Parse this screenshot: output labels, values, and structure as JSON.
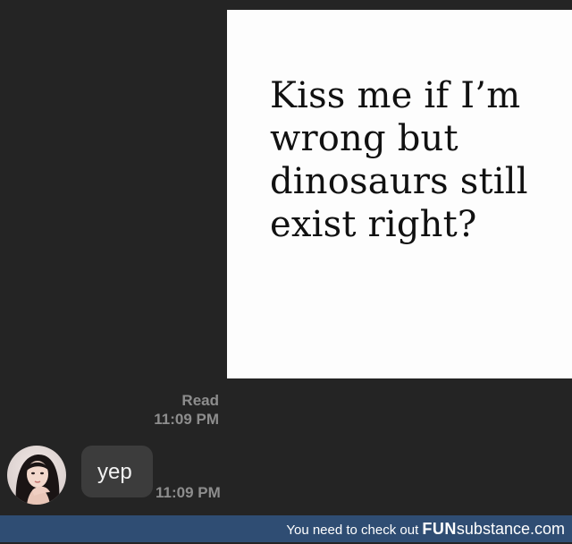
{
  "chat": {
    "image_message": {
      "lines": [
        "Kiss me if I’m",
        "wrong but",
        "dinosaurs still",
        "exist right?"
      ]
    },
    "read_status": {
      "label": "Read",
      "time": "11:09 PM"
    },
    "reply": {
      "text": "yep",
      "time": "11:09 PM"
    }
  },
  "footer": {
    "prefix": "You need to check out ",
    "brand_bold": "FUN",
    "brand_rest": "substance",
    "brand_tld": ".com"
  },
  "colors": {
    "background": "#242424",
    "bubble": "#3c3c3c",
    "timestamp": "#8d8d8d",
    "footer": "#2f4d73"
  }
}
